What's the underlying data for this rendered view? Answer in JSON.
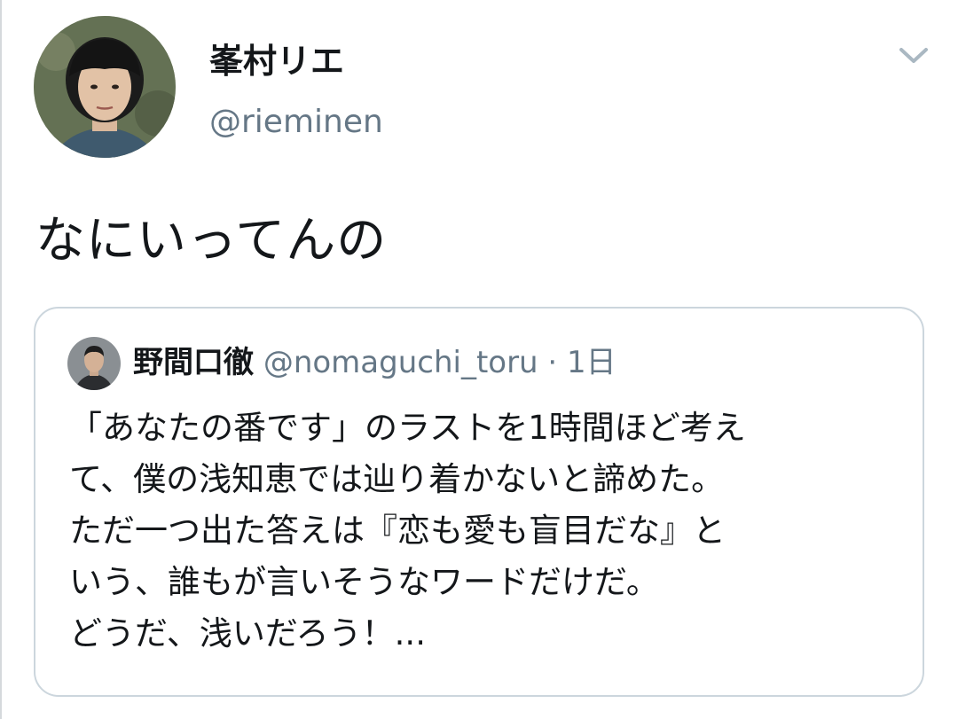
{
  "tweet": {
    "author": {
      "display_name": "峯村リエ",
      "handle": "@rieminen"
    },
    "text": "なにいってんの",
    "menu_icon": "chevron-down-icon"
  },
  "quoted_tweet": {
    "author": {
      "display_name": "野間口徹",
      "handle": "@nomaguchi_toru"
    },
    "separator": "·",
    "time": "1日",
    "body_lines": [
      "「あなたの番です」のラストを1時間ほど考え",
      "て、僕の浅知恵では辿り着かないと諦めた。",
      "ただ一つ出た答えは『恋も愛も盲目だな』と",
      "いう、誰もが言いそうなワードだけだ。",
      "どうだ、浅いだろう！..."
    ]
  },
  "colors": {
    "text_primary": "#14171a",
    "text_secondary": "#657786",
    "border": "#ccd6dd"
  }
}
